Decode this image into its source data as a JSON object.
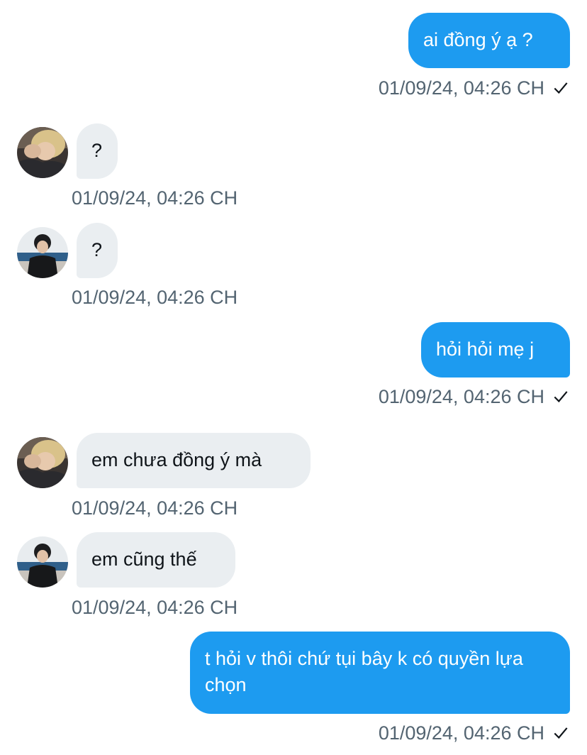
{
  "messages": [
    {
      "direction": "out",
      "text": "ai đồng ý ạ ?",
      "time": "01/09/24, 04:26 CH",
      "status_icon": "check-icon"
    },
    {
      "direction": "in",
      "avatar": "avatar-blonde",
      "text": "?",
      "time": "01/09/24, 04:26 CH"
    },
    {
      "direction": "in",
      "avatar": "avatar-dark",
      "text": "?",
      "time": "01/09/24, 04:26 CH"
    },
    {
      "direction": "out",
      "text": "hỏi hỏi mẹ j",
      "time": "01/09/24, 04:26 CH",
      "status_icon": "check-icon"
    },
    {
      "direction": "in",
      "avatar": "avatar-blonde",
      "text": "em chưa đồng ý mà",
      "time": "01/09/24, 04:26 CH"
    },
    {
      "direction": "in",
      "avatar": "avatar-dark",
      "text": "em cũng thế",
      "time": "01/09/24, 04:26 CH"
    },
    {
      "direction": "out",
      "text": "t hỏi v thôi chứ tụi bây k có quyền lựa chọn",
      "time": "01/09/24, 04:26 CH",
      "status_icon": "check-icon"
    }
  ],
  "colors": {
    "outgoing_bubble": "#1d9bf0",
    "incoming_bubble": "#eaeef1",
    "timestamp": "#536471",
    "incoming_text": "#0f1419"
  }
}
